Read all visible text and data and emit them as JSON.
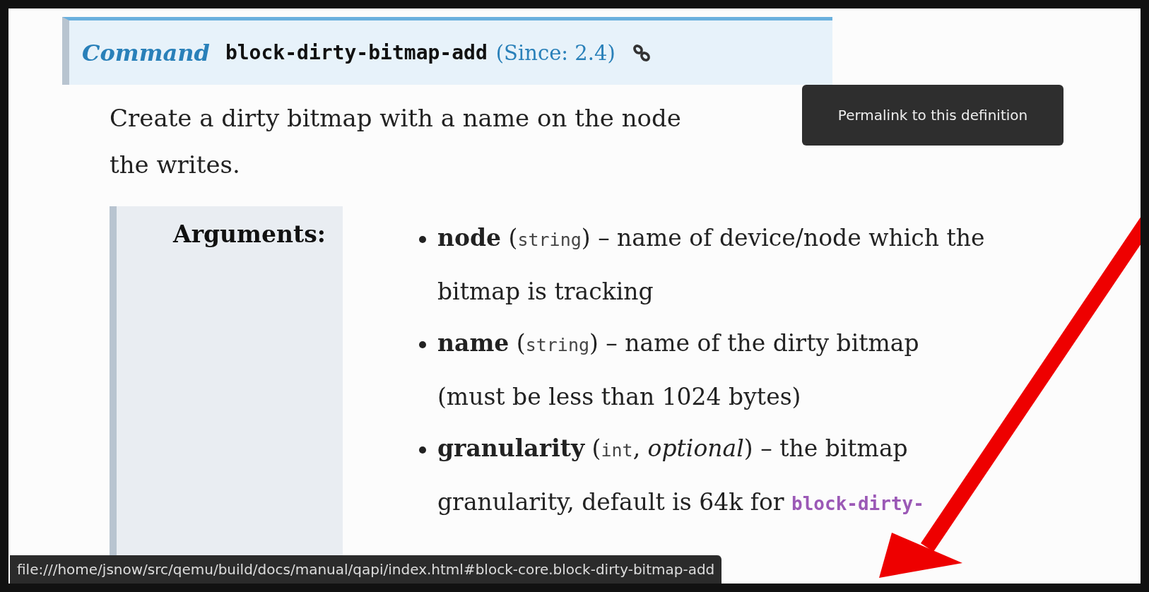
{
  "definition": {
    "kind_label": "Command",
    "name": "block-dirty-bitmap-add",
    "since": "(Since: 2.4)",
    "tooltip": "Permalink to this definition"
  },
  "description": [
    "Create a dirty bitmap with a name on the node",
    "the writes."
  ],
  "arguments": {
    "label": "Arguments:",
    "items": [
      {
        "parts": [
          {
            "kind": "bold",
            "text": "node"
          },
          {
            "kind": "plain",
            "text": " ("
          },
          {
            "kind": "code",
            "text": "string"
          },
          {
            "kind": "plain",
            "text": ") – name of device/node which the bitmap is tracking"
          }
        ]
      },
      {
        "parts": [
          {
            "kind": "bold",
            "text": "name"
          },
          {
            "kind": "plain",
            "text": " ("
          },
          {
            "kind": "code",
            "text": "string"
          },
          {
            "kind": "plain",
            "text": ") – name of the dirty bitmap (must be less than 1024 bytes)"
          }
        ]
      },
      {
        "parts": [
          {
            "kind": "bold",
            "text": "granularity"
          },
          {
            "kind": "plain",
            "text": " ("
          },
          {
            "kind": "code",
            "text": "int"
          },
          {
            "kind": "plain",
            "text": ", "
          },
          {
            "kind": "italic",
            "text": "optional"
          },
          {
            "kind": "plain",
            "text": ") – the bitmap granularity, default is 64k for "
          },
          {
            "kind": "link",
            "text": "block-dirty-"
          }
        ]
      }
    ]
  },
  "status_bar": {
    "url": "file:///home/jsnow/src/qemu/build/docs/manual/qapi/index.html#block-core.block-dirty-bitmap-add"
  }
}
